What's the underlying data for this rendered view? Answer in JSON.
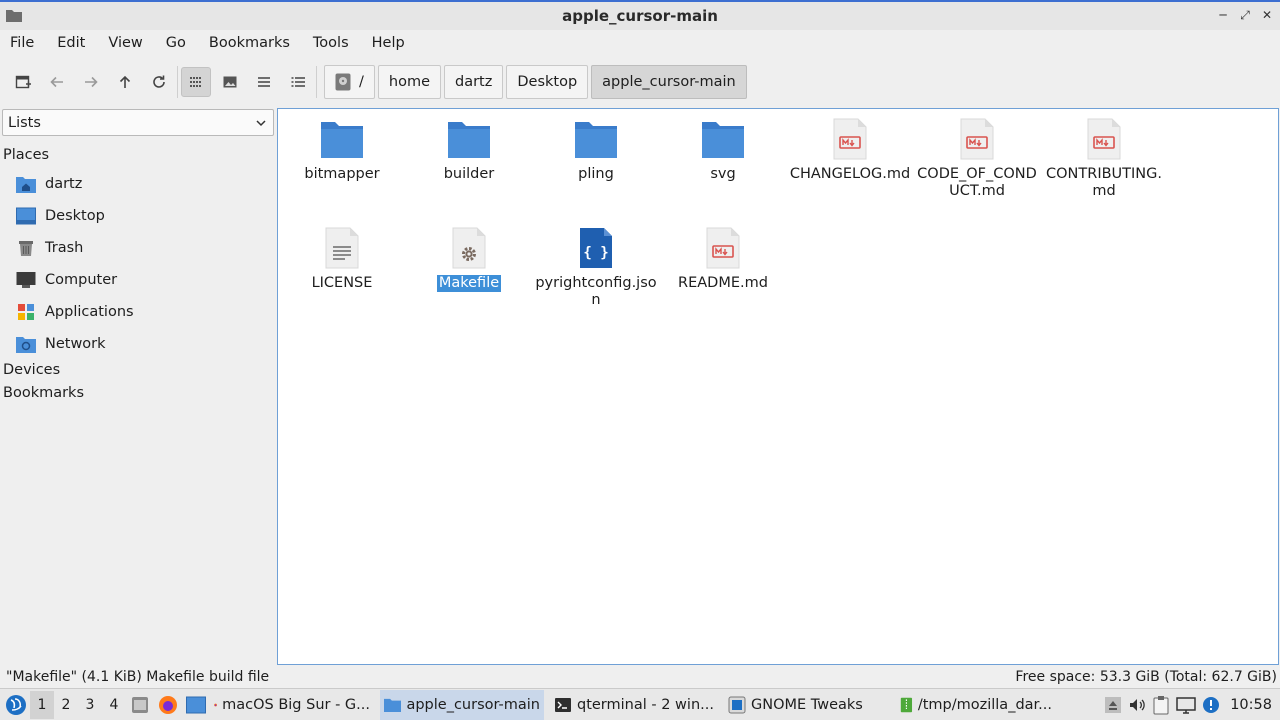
{
  "window": {
    "title": "apple_cursor-main",
    "controls": [
      "minimize",
      "maximize",
      "close"
    ]
  },
  "menu": [
    "File",
    "Edit",
    "View",
    "Go",
    "Bookmarks",
    "Tools",
    "Help"
  ],
  "toolbar": {
    "buttons": [
      "new-tab-icon",
      "back-icon",
      "forward-icon",
      "up-icon",
      "reload-icon",
      "icon-view-icon",
      "thumbnail-view-icon",
      "compact-view-icon",
      "detailed-list-view-icon"
    ],
    "active_view": "icon-view"
  },
  "breadcrumb": {
    "root": "/",
    "items": [
      "home",
      "dartz",
      "Desktop",
      "apple_cursor-main"
    ]
  },
  "sidebar": {
    "selector": "Lists",
    "places_heading": "Places",
    "places": [
      {
        "label": "dartz",
        "icon": "home-folder-icon"
      },
      {
        "label": "Desktop",
        "icon": "desktop-icon"
      },
      {
        "label": "Trash",
        "icon": "trash-icon"
      },
      {
        "label": "Computer",
        "icon": "computer-icon"
      },
      {
        "label": "Applications",
        "icon": "applications-icon"
      },
      {
        "label": "Network",
        "icon": "network-icon"
      }
    ],
    "devices_heading": "Devices",
    "bookmarks_heading": "Bookmarks"
  },
  "files": [
    {
      "name": "bitmapper",
      "type": "folder"
    },
    {
      "name": "builder",
      "type": "folder"
    },
    {
      "name": "pling",
      "type": "folder"
    },
    {
      "name": "svg",
      "type": "folder"
    },
    {
      "name": "CHANGELOG.md",
      "type": "markdown"
    },
    {
      "name": "CODE_OF_COND UCT.md",
      "type": "markdown"
    },
    {
      "name": "CONTRIBUTING. md",
      "type": "markdown"
    },
    {
      "name": "LICENSE",
      "type": "text"
    },
    {
      "name": "Makefile",
      "type": "makefile",
      "selected": true
    },
    {
      "name": "pyrightconfig.jso n",
      "type": "json"
    },
    {
      "name": "README.md",
      "type": "markdown"
    }
  ],
  "status": {
    "left": "\"Makefile\" (4.1 KiB) Makefile build file",
    "right": "Free space: 53.3 GiB (Total: 62.7 GiB)"
  },
  "taskbar": {
    "workspaces": [
      "1",
      "2",
      "3",
      "4"
    ],
    "active_workspace": "1",
    "tasks": [
      {
        "label": "macOS Big Sur - G...",
        "icon": "firefox-icon"
      },
      {
        "label": "apple_cursor-main",
        "icon": "folder-icon",
        "active": true
      },
      {
        "label": "qterminal - 2 win...",
        "icon": "terminal-icon"
      },
      {
        "label": "GNOME Tweaks",
        "icon": "tweaks-icon"
      },
      {
        "label": "/tmp/mozilla_dar...",
        "icon": "archive-icon"
      }
    ],
    "clock": "10:58"
  },
  "colors": {
    "accent": "#3d8fd8",
    "folder": "#4a8fd9",
    "markdown_badge": "#d9534f"
  }
}
